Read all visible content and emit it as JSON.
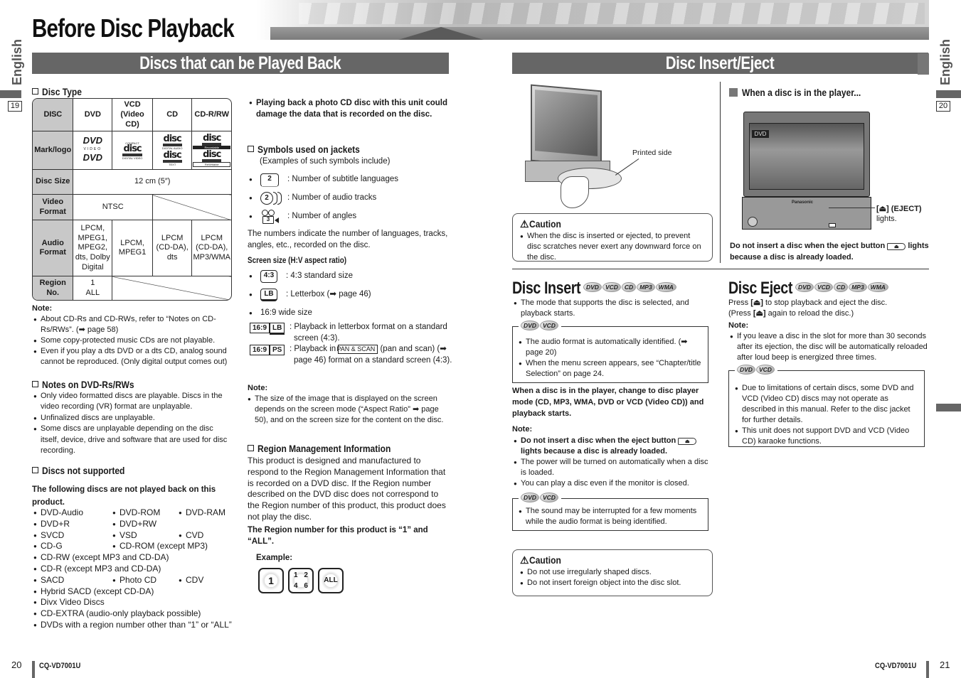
{
  "header": {
    "title": "Before Disc Playback"
  },
  "left_page": {
    "lang_tab": "English",
    "section_ref": "19",
    "section_title": "Discs that can be Played Back",
    "disc_type": {
      "heading": "Disc Type",
      "columns": [
        "DISC",
        "DVD",
        "VCD\n(Video CD)",
        "CD",
        "CD-R/RW"
      ],
      "rows": [
        {
          "label": "Mark/logo",
          "cells": [
            "DVD VIDEO / DVD",
            "compact disc DIGITAL VIDEO",
            "compact disc DIGITAL AUDIO / TEXT",
            "compact disc Recordable / ReWritable"
          ]
        },
        {
          "label": "Disc Size",
          "value": "12 cm (5″)"
        },
        {
          "label": "Video\nFormat",
          "value": "NTSC"
        },
        {
          "label": "Audio\nFormat",
          "cells": [
            "LPCM,\nMPEG1,\nMPEG2,\ndts, Dolby\nDigital",
            "LPCM,\nMPEG1",
            "LPCM\n(CD-DA),\ndts",
            "LPCM\n(CD-DA),\nMP3/WMA"
          ]
        },
        {
          "label": "Region\nNo.",
          "value": "1\nALL"
        }
      ],
      "logos": {
        "dvd_video": "DVD",
        "dvd_video_sub": "VIDEO",
        "cd_word": "disc",
        "cd_top": "COMPACT",
        "vcd_sub": "DIGITAL VIDEO",
        "cd_sub": "DIGITAL AUDIO",
        "cd_text_sub": "TEXT",
        "cdr_sub": "Recordable",
        "cdrw_sub": "ReWritable"
      }
    },
    "note1": {
      "title": "Note:",
      "items": [
        "About CD-Rs and CD-RWs, refer to “Notes on CD-Rs/RWs”. (➡ page 58)",
        "Some copy-protected music CDs are not playable.",
        "Even if you play a dts DVD or a dts CD, analog sound cannot be reproduced. (Only digital output comes out)"
      ]
    },
    "notes_dvdr": {
      "heading": "Notes on DVD-Rs/RWs",
      "items": [
        "Only video formatted discs are playable.  Discs in the video recording (VR) format are unplayable.",
        "Unfinalized discs are unplayable.",
        "Some discs are unplayable depending on the disc itself, device, drive and software that are used for disc recording."
      ]
    },
    "not_supported": {
      "heading": "Discs not supported",
      "intro": "The following discs are not played back on this product.",
      "rows": [
        [
          "DVD-Audio",
          "DVD-ROM",
          "DVD-RAM"
        ],
        [
          "DVD+R",
          "DVD+RW"
        ],
        [
          "SVCD",
          "VSD",
          "CVD"
        ],
        [
          "CD-G",
          "CD-ROM (except MP3)"
        ],
        [
          "CD-RW (except MP3 and CD-DA)"
        ],
        [
          "CD-R (except MP3 and CD-DA)"
        ],
        [
          "SACD",
          "Photo CD",
          "CDV"
        ],
        [
          "Hybrid SACD (except CD-DA)"
        ],
        [
          "Divx Video Discs"
        ],
        [
          "CD-EXTRA (audio-only playback possible)"
        ],
        [
          "DVDs with a region number other than “1” or “ALL”"
        ]
      ]
    },
    "photo_cd_warning": "Playing back a photo CD disc with this unit could damage the data that is recorded on the disc.",
    "symbols": {
      "heading": "Symbols used on jackets",
      "intro": "(Examples of such symbols include)",
      "items": [
        {
          "icon": "subtitle-icon",
          "icon_text": "2",
          "text": ": Number of subtitle languages"
        },
        {
          "icon": "audio-tracks-icon",
          "icon_text": "2",
          "text": ": Number of audio tracks"
        },
        {
          "icon": "angles-icon",
          "icon_text": "3",
          "text": ": Number of angles"
        }
      ],
      "explanation": "The numbers indicate the number of languages, tracks, angles, etc., recorded on the disc."
    },
    "screen_size": {
      "heading": "Screen size (H:V aspect ratio)",
      "items": [
        {
          "icon_text": "4:3",
          "text": ": 4:3 standard size"
        },
        {
          "icon_text": "LB",
          "text": ": Letterbox (➡ page 46)"
        }
      ],
      "wide_label": "16:9 wide size",
      "wide_items": [
        {
          "tag1": "16:9",
          "tag2": "LB",
          "text": ": Playback in letterbox format on a standard screen (4:3)."
        },
        {
          "tag1": "16:9",
          "tag2": "PS",
          "text_before": ": Playback in",
          "pan_scan": "PAN & SCAN",
          "text_after": "(pan and scan) (➡ page 46) format on a standard screen (4:3)."
        }
      ]
    },
    "note2": {
      "title": "Note:",
      "items": [
        "The size of the image that is displayed on the screen depends on the screen mode (“Aspect Ratio” ➡ page 50), and on the screen size for the content on the disc."
      ]
    },
    "region": {
      "heading": "Region Management Information",
      "body": "This product is designed and manufactured to respond to the Region Management Information that is recorded on a DVD disc. If the Region number described on the DVD disc does not correspond to the Region number of this product, this product does not play the disc.",
      "bold": "The Region number for this product is “1” and “ALL”.",
      "example_label": "Example:",
      "examples": [
        "1",
        "1 2 4 6",
        "ALL"
      ]
    },
    "footer": {
      "page_number": "20",
      "model": "CQ-VD7001U"
    }
  },
  "right_page": {
    "lang_tab": "English",
    "section_ref": "20",
    "section_title": "Disc Insert/Eject",
    "illustration_label": "Printed side",
    "caution1": {
      "title": "Caution",
      "items": [
        "When the disc is inserted or ejected, to prevent disc scratches never exert any downward force on the disc."
      ]
    },
    "in_player": {
      "heading": "When a disc is in the player...",
      "eject_callout": "[⏏] (EJECT)",
      "eject_callout2": "lights.",
      "warning_before": "Do not insert a disc when the eject button",
      "warning_after": "lights because a disc is already loaded.",
      "screen_label": "DVD",
      "brand": "Panasonic"
    },
    "disc_insert": {
      "title": "Disc Insert",
      "badges": [
        "DVD",
        "VCD",
        "CD",
        "MP3",
        "WMA"
      ],
      "items": [
        "The mode that supports the disc is selected, and playback starts."
      ],
      "box_badges": [
        "DVD",
        "VCD"
      ],
      "box_items": [
        "The audio format is automatically identified. (➡ page 20)",
        "When the menu screen appears, see “Chapter/title Selection” on page 24."
      ],
      "bold_para": "When a disc is in the player, change to disc player mode (CD, MP3, WMA, DVD or VCD (Video CD)) and playback starts.",
      "note_title": "Note:",
      "note_bold_before": "Do not insert a disc when the eject button",
      "note_bold_after": "lights because a disc is already loaded.",
      "note_items": [
        "The power will be turned on automatically when a disc is loaded.",
        "You can play a disc even if the monitor is closed."
      ],
      "box2_badges": [
        "DVD",
        "VCD"
      ],
      "box2_items": [
        "The sound may be interrupted for a few moments while the audio format is being identified."
      ]
    },
    "caution2": {
      "title": "Caution",
      "items": [
        "Do not use irregularly shaped discs.",
        "Do not insert foreign object into the disc slot."
      ]
    },
    "disc_eject": {
      "title": "Disc Eject",
      "badges": [
        "DVD",
        "VCD",
        "CD",
        "MP3",
        "WMA"
      ],
      "line1_before": "Press",
      "line1_key": "[⏏]",
      "line1_after": "to stop playback and eject the disc.",
      "line2_before": "(Press",
      "line2_key": "[⏏]",
      "line2_after": "again to reload the disc.)",
      "note_title": "Note:",
      "note_items": [
        "If you leave a disc in the slot for more than 30 seconds after its ejection, the disc will be automatically reloaded after loud beep is energized three times."
      ],
      "box_badges": [
        "DVD",
        "VCD"
      ],
      "box_items": [
        "Due to limitations of certain discs, some DVD and VCD (Video CD) discs may not operate as described in this manual. Refer to the disc jacket for further details.",
        "This unit does not support DVD and VCD (Video CD) karaoke functions."
      ]
    },
    "footer": {
      "page_number": "21",
      "model": "CQ-VD7001U"
    }
  }
}
